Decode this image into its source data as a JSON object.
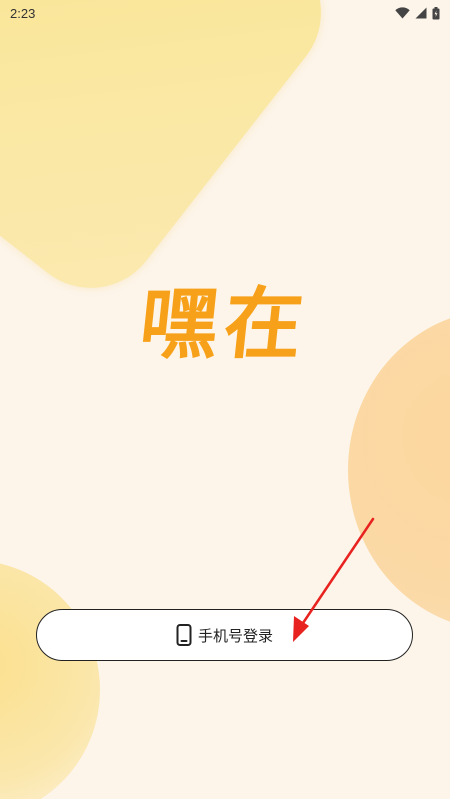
{
  "status_bar": {
    "time": "2:23",
    "icons": [
      "wifi-icon",
      "signal-icon",
      "battery-icon"
    ]
  },
  "app": {
    "logo_text": "嘿在",
    "brand_color": "#f7a11a",
    "background_color": "#fdf5ea"
  },
  "login": {
    "button_label": "手机号登录",
    "icon": "phone-icon"
  },
  "annotation": {
    "arrow_color": "#e8231f"
  }
}
